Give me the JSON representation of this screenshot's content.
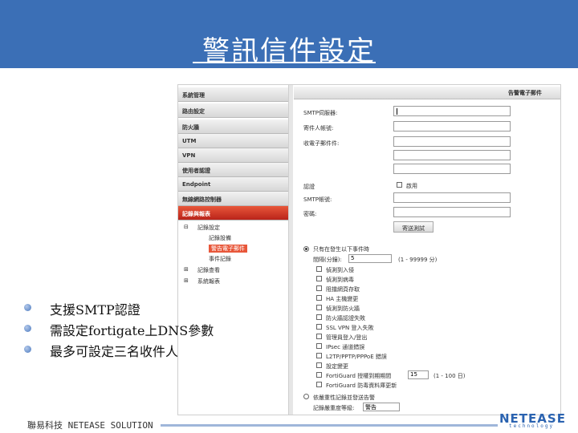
{
  "slide": {
    "title": "警訊信件設定",
    "bullets": [
      "支援SMTP認證",
      "需設定fortigate上DNS參數",
      "最多可設定三名收件人"
    ],
    "footer": "聯易科技 NETEASE SOLUTION",
    "logo_main": "NETEASE",
    "logo_sub": "technology",
    "accent": "#3b6fb6"
  },
  "screenshot": {
    "menu": [
      "系統管理",
      "路由設定",
      "防火牆",
      "UTM",
      "VPN",
      "使用者認證",
      "Endpoint",
      "無線網路控制器",
      "記錄與報表"
    ],
    "active_menu_index": 8,
    "tree": [
      {
        "label": "記錄設定",
        "sign": "⊟",
        "sel": false
      },
      {
        "label": "記錄設備",
        "sign": "",
        "sel": false
      },
      {
        "label": "警告電子郵件",
        "sign": "",
        "sel": true
      },
      {
        "label": "事件記錄",
        "sign": "",
        "sel": false
      },
      {
        "label": "記錄查看",
        "sign": "⊞",
        "sel": false
      },
      {
        "label": "系統報表",
        "sign": "⊞",
        "sel": false
      }
    ],
    "panel_title": "告警電子郵件",
    "form": {
      "smtp_server": "SMTP伺服器:",
      "email_from": "寄件人帳號:",
      "email_to": "收電子郵件件:",
      "auth": "認證",
      "enable": "啟用",
      "smtp_user": "SMTP帳號:",
      "password": "密碼:",
      "test_button": "寄送測試"
    },
    "send_option": "只有在發生以下事件時",
    "interval_label": "間隔(分鐘):",
    "interval_value": "5",
    "interval_range": "(1 - 99999 分)",
    "events": [
      "偵測到入侵",
      "偵測到病毒",
      "阻擋網頁存取",
      "HA 主機變更",
      "偵測到防火牆",
      "防火牆認證失敗",
      "SSL VPN 登入失敗",
      "管理員登入/登出",
      "IPsec 通道錯誤",
      "L2TP/PPTP/PPPoE 錯誤",
      "設定變更",
      "FortiGuard 授權到期期間",
      "FortiGuard 防毒資料庫更新"
    ],
    "license_value": "15",
    "license_range": "(1 - 100 日)",
    "send_option2": "依嚴重性記錄並發送告警",
    "severity_label": "記錄嚴重度等級:",
    "severity_value": "警告"
  }
}
